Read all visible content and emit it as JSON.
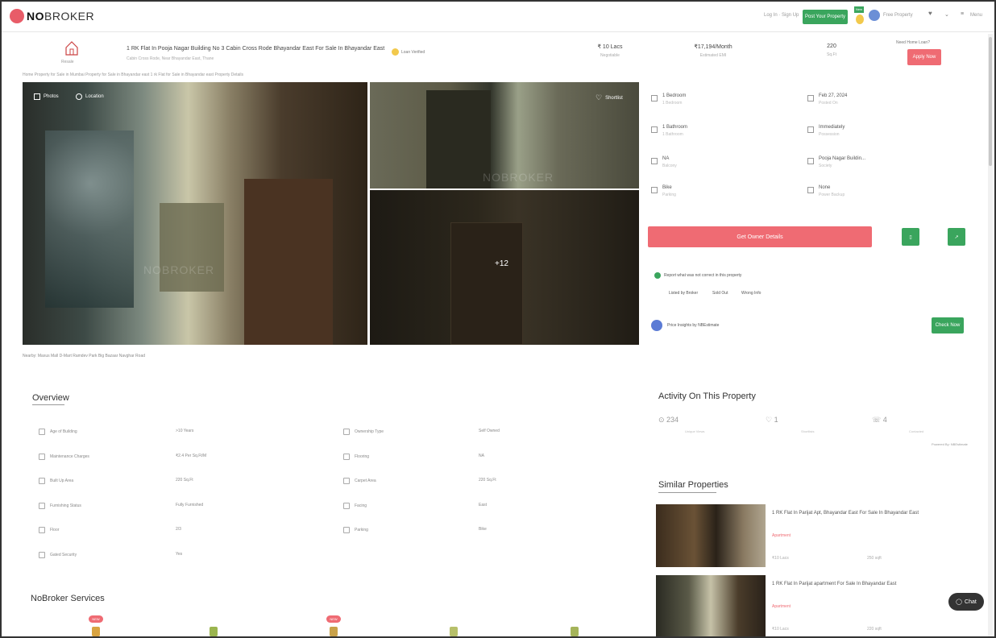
{
  "header": {
    "logo_prefix": "NO",
    "logo_suffix": "BROKER",
    "for_you": "Log In · Sign Up",
    "post_button": "Post Your Property",
    "new_badge": "New",
    "user": "Free Property",
    "menu": "Menu"
  },
  "property": {
    "home_label": "Resale",
    "title": "1 RK Flat In Pooja Nagar Building No 3 Cabin Cross Rode Bhayandar East For Sale In Bhayandar East",
    "subtitle": "Cabin Cross Rode, Near Bhayandar East, Thane",
    "verified": "Loan Verified",
    "price": "₹ 10 Lacs",
    "price_label": "Negotiable",
    "emi": "₹17,194/Month",
    "emi_label": "Estimated EMI",
    "area": "220",
    "area_label": "Sq.Ft",
    "loan_question": "Need Home Loan?",
    "loan_button": "Apply Now"
  },
  "breadcrumb": "Home  Property for Sale in Mumbai  Property for Sale in Bhayandar east  1 rk Flat for Sale in Bhayandar east  Property Details",
  "gallery": {
    "photos_label": "Photos",
    "location_label": "Location",
    "shortlist_label": "Shortlist",
    "more_count": "+12",
    "watermark": "NOBROKER"
  },
  "nearby": "Nearby:  Maxus Mall  D-Mart  Ramdev Park  Big Bazaar  Navghar Road",
  "details": [
    {
      "value": "1 Bedroom",
      "label": "1 Bedroom"
    },
    {
      "value": "Feb 27, 2024",
      "label": "Posted On"
    },
    {
      "value": "1 Bathroom",
      "label": "1 Bathroom"
    },
    {
      "value": "Immediately",
      "label": "Possession"
    },
    {
      "value": "NA",
      "label": "Balcony"
    },
    {
      "value": "Pooja Nagar Buildin...",
      "label": "Society"
    },
    {
      "value": "Bike",
      "label": "Parking"
    },
    {
      "value": "None",
      "label": "Power Backup"
    }
  ],
  "contact_button": "Get Owner Details",
  "report": {
    "text": "Report what was not correct in this property",
    "options": [
      "Listed by Broker",
      "Sold Out",
      "Wrong Info"
    ]
  },
  "estimate": {
    "text": "Price Insights by NBEstimate",
    "button": "Check Now"
  },
  "activity": {
    "title": "Activity On This Property",
    "stats": [
      {
        "value": "234",
        "label": "Unique Views"
      },
      {
        "value": "1",
        "label": "Shortlists"
      },
      {
        "value": "4",
        "label": "Contacted"
      }
    ],
    "powered": "Powered By: NBEstimate"
  },
  "overview": {
    "title": "Overview",
    "rows": [
      {
        "label": "Age of Building",
        "value": ">10 Years",
        "label2": "Ownership Type",
        "value2": "Self Owned"
      },
      {
        "label": "Maintenance Charges",
        "value": "₹2.4 Per Sq.Ft/M",
        "label2": "Flooring",
        "value2": "NA"
      },
      {
        "label": "Built Up Area",
        "value": "220 Sq.Ft",
        "label2": "Carpet Area",
        "value2": "220 Sq.Ft"
      },
      {
        "label": "Furnishing Status",
        "value": "Fully Furnished",
        "label2": "Facing",
        "value2": "East"
      },
      {
        "label": "Floor",
        "value": "2/3",
        "label2": "Parking",
        "value2": "Bike"
      },
      {
        "label": "Gated Security",
        "value": "Yes",
        "label2": "",
        "value2": ""
      }
    ]
  },
  "similar": {
    "title": "Similar Properties",
    "items": [
      {
        "title": "1 RK Flat In Parijat Apt, Bhayandar East For Sale In Bhayandar East",
        "tag": "Apartment",
        "price": "₹10 Lacs",
        "area": "250 sqft"
      },
      {
        "title": "1 RK Flat In Parijat apartment For Sale In Bhayandar East",
        "tag": "Apartment",
        "price": "₹10 Lacs",
        "area": "220 sqft"
      }
    ]
  },
  "services": {
    "title": "NoBroker Services",
    "badge1": "NEW",
    "badge2": "NEW"
  },
  "chat_label": "Chat"
}
